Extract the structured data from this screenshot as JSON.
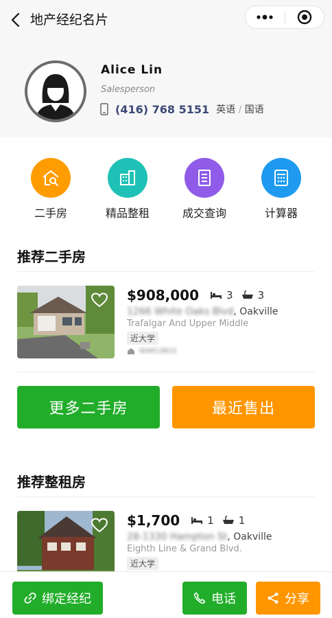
{
  "header": {
    "title": "地产经纪名片",
    "back_icon": "chevron-left-icon",
    "more_icon": "more-dots-icon",
    "target_icon": "target-icon"
  },
  "agent": {
    "name": "Alice Lin",
    "role": "Salesperson",
    "phone": "(416) 768 5151",
    "lang_1": "英语",
    "lang_sep": "/",
    "lang_2": "国语"
  },
  "quick_menu": [
    {
      "label": "二手房",
      "icon": "house-search-icon",
      "color": "#ff9c00"
    },
    {
      "label": "精品整租",
      "icon": "building-icon",
      "color": "#1fc1b6"
    },
    {
      "label": "成交查询",
      "icon": "document-icon",
      "color": "#8f5be8"
    },
    {
      "label": "计算器",
      "icon": "calculator-icon",
      "color": "#1e9bf0"
    }
  ],
  "resale": {
    "section_title": "推荐二手房",
    "listing": {
      "price": "$908,000",
      "beds": "3",
      "baths": "3",
      "street": "1266 White Oaks Blvd",
      "city": ", Oakville",
      "intersection": "Trafalgar And Upper Middle",
      "tag": "近大学",
      "mls": "W4613815"
    },
    "more_button": "更多二手房",
    "sold_button": "最近售出"
  },
  "rental": {
    "section_title": "推荐整租房",
    "listing": {
      "price": "$1,700",
      "beds": "1",
      "baths": "1",
      "street": "28-1330 Hampton St",
      "city": ", Oakville",
      "intersection": "Eighth Line & Grand Blvd.",
      "tag": "近大学"
    }
  },
  "bottom_bar": {
    "bind_label": "绑定经纪",
    "call_label": "电话",
    "share_label": "分享"
  },
  "colors": {
    "green": "#21ad2a",
    "orange": "#ff9600",
    "phone_text": "#3d4a78"
  }
}
